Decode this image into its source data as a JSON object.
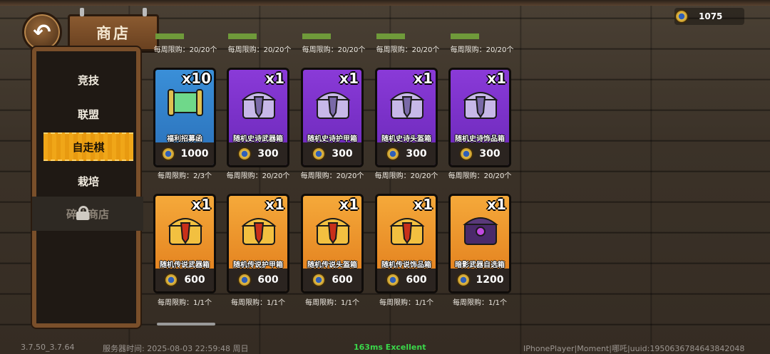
{
  "header": {
    "title": "商店",
    "currency_amount": "1075"
  },
  "sidebar": {
    "items": [
      {
        "label": "竞技"
      },
      {
        "label": "联盟"
      },
      {
        "label": "自走棋"
      },
      {
        "label": "栽培"
      },
      {
        "label": "碎片商店"
      }
    ]
  },
  "top_row_limits": [
    "每周限购：20/20个",
    "每周限购：20/20个",
    "每周限购：20/20个",
    "每周限购：20/20个",
    "每周限购：20/20个"
  ],
  "row1": [
    {
      "qty": "x10",
      "name": "福利招募函",
      "price": "1000",
      "limit": "每周限购：2/3个",
      "color": "blue",
      "icon": "scroll-icon"
    },
    {
      "qty": "x1",
      "name": "随机史诗武器箱",
      "price": "300",
      "limit": "每周限购：20/20个",
      "color": "purple",
      "icon": "chest-sword-icon"
    },
    {
      "qty": "x1",
      "name": "随机史诗护甲箱",
      "price": "300",
      "limit": "每周限购：20/20个",
      "color": "purple",
      "icon": "chest-shield-icon"
    },
    {
      "qty": "x1",
      "name": "随机史诗头盔箱",
      "price": "300",
      "limit": "每周限购：20/20个",
      "color": "purple",
      "icon": "chest-helmet-icon"
    },
    {
      "qty": "x1",
      "name": "随机史诗饰品箱",
      "price": "300",
      "limit": "每周限购：20/20个",
      "color": "purple",
      "icon": "chest-gem-icon"
    }
  ],
  "row2": [
    {
      "qty": "x1",
      "name": "随机传说武器箱",
      "price": "600",
      "limit": "每周限购：1/1个",
      "color": "gold",
      "icon": "chest-sword-icon"
    },
    {
      "qty": "x1",
      "name": "随机传说护甲箱",
      "price": "600",
      "limit": "每周限购：1/1个",
      "color": "gold",
      "icon": "chest-shield-icon"
    },
    {
      "qty": "x1",
      "name": "随机传说头盔箱",
      "price": "600",
      "limit": "每周限购：1/1个",
      "color": "gold",
      "icon": "chest-helmet-icon"
    },
    {
      "qty": "x1",
      "name": "随机传说饰品箱",
      "price": "600",
      "limit": "每周限购：1/1个",
      "color": "gold",
      "icon": "chest-gem-icon"
    },
    {
      "qty": "x1",
      "name": "暗影武器自选箱",
      "price": "1200",
      "limit": "每周限购：1/1个",
      "color": "gold",
      "icon": "dark-chest-icon"
    }
  ],
  "footer": {
    "version": "3.7.50_3.7.64",
    "server_time": "服务器时间:   2025-08-03  22:59:48  周日",
    "ping": "163ms Excellent",
    "player": "IPhonePlayer|Moment|哪吒|uuid:1950636784643842048"
  }
}
